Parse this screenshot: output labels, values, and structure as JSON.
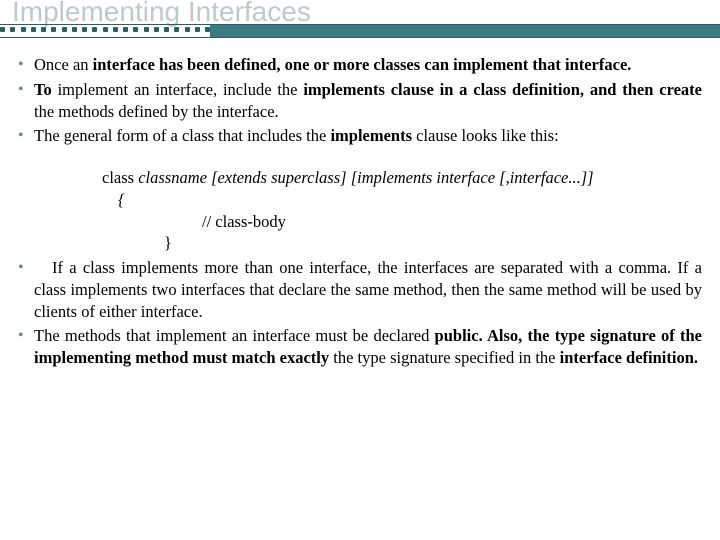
{
  "title": "Implementing Interfaces",
  "bullets": {
    "b1a": "Once an ",
    "b1b": "interface has been defined, one or more classes can implement that interface.",
    "b2a": "To ",
    "b2b": "implement an interface, include the ",
    "b2c": "implements clause in a class definition, and then create ",
    "b2d": "the methods defined by the interface.",
    "b3a": "The general form of a class that includes the ",
    "b3b": "implements ",
    "b3c": "clause looks like this:",
    "b4a": "If a class implements more than one interface, the interfaces are separated with a comma. If a class implements two interfaces that declare the same method, then the same method will be used by clients of either interface.",
    "b5a": "The methods that implement an interface must be declared ",
    "b5b": "public. Also, the type signature of the implementing method must match exactly ",
    "b5c": "the type signature specified in the ",
    "b5d": "interface definition."
  },
  "code": {
    "l1a": "class ",
    "l1b": "classname [extends superclass] [implements interface [,interface...]]",
    "l2": "{",
    "l3": "// class-body",
    "l4": "}"
  }
}
